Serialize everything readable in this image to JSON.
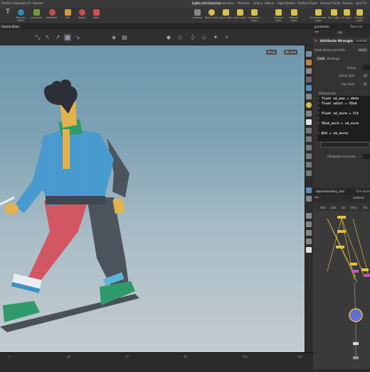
{
  "shelf_tabs": [
    "Particle FX",
    "Sample FX",
    "Volume",
    "Lights and Cameras",
    "Collisions",
    "Particles",
    "Grains",
    "Vellum",
    "Rigid Bodies",
    "Particle Fluids",
    "Viscous Fluids",
    "Oceans",
    "Pyro FX"
  ],
  "shelf_tools_left": [
    "T",
    "Platonic Solids",
    "L-System",
    "Metaball",
    "File",
    "Spiral",
    "Helix"
  ],
  "shelf_tools_right": [
    "Camera",
    "Point Light",
    "Spot Light",
    "Area Light",
    "Geometry Light",
    "Volume Light",
    "Distant Light",
    "Environment Light",
    "Sky Light",
    "GI Light",
    "Caustic Light",
    "Portal Light",
    "Ambient Light"
  ],
  "pane_tabs": {
    "left": "Scene View",
    "right1": "Take List",
    "right2": "parameter"
  },
  "viewport": {
    "persp_label": "Persp",
    "cam_label": "No cam"
  },
  "timeline_ticks": [
    "1",
    "48",
    "72",
    "96",
    "120",
    "144",
    "168",
    "192"
  ],
  "right_panel": {
    "path": "obj",
    "node_type": "Attribute Wrangle",
    "node_name": "normal",
    "asset_name_label": "Asset Name and Path",
    "attrib_button": "attrib",
    "tab_code": "Code",
    "tab_bindings": "Bindings",
    "group_label": "Group",
    "group_type_label": "Group Type",
    "group_type_value": "G",
    "run_over_label": "Run Over",
    "run_over_value": "P",
    "vexpression_label": "VEXpression",
    "code_lines": [
      {
        "num": "1",
        "text": "float sd_max = dete"
      },
      {
        "num": "2",
        "text": "float sdist = f@sd"
      },
      {
        "num": "3",
        "text": ""
      },
      {
        "num": "4",
        "text": "float sd_norm = fit"
      },
      {
        "num": "5",
        "text": ""
      },
      {
        "num": "6",
        "text": "f@sd_norm = sd_norm"
      },
      {
        "num": "7",
        "text": ""
      },
      {
        "num": "8",
        "text": "@Cd = sd_norm;"
      }
    ],
    "attributes_to_create_label": "Attributes to Create",
    "network_path": "obj/embroidery_tool",
    "network_tab2": "Tree View",
    "network_node": "embroi",
    "net_menu": [
      "Add",
      "Edit",
      "Go",
      "View",
      "Too"
    ]
  },
  "colors": {
    "accent": "#e8b93a",
    "viewport_top": "#6d97ab",
    "viewport_bottom": "#c5ccd0",
    "node_selected": "#5d6fd0"
  }
}
